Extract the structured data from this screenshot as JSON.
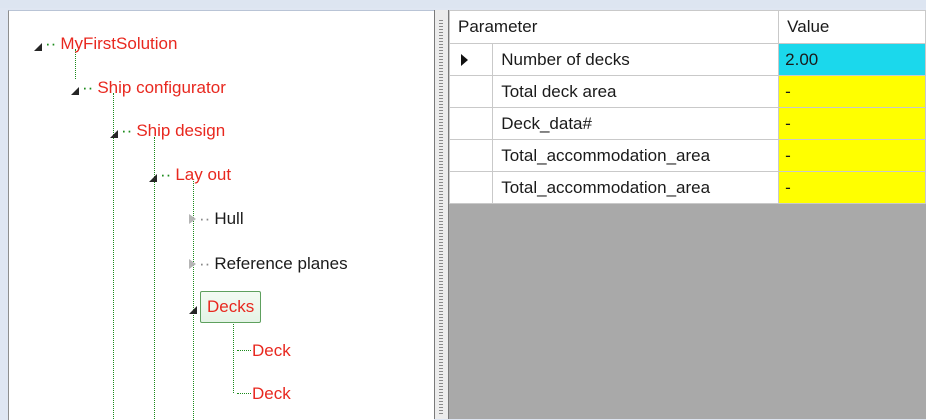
{
  "tree": {
    "root": "MyFirstSolution",
    "ship_configurator": "Ship configurator",
    "ship_design": "Ship design",
    "lay_out": "Lay out",
    "hull": "Hull",
    "reference_planes": "Reference planes",
    "decks": "Decks",
    "deck1": "Deck",
    "deck2": "Deck"
  },
  "grid": {
    "headers": {
      "parameter": "Parameter",
      "value": "Value"
    },
    "rows": [
      {
        "parameter": "Number of decks",
        "value": "2.00",
        "color": "#1bd8ec",
        "current": true
      },
      {
        "parameter": "Total deck area",
        "value": "-",
        "color": "#ffff00",
        "current": false
      },
      {
        "parameter": "Deck_data#",
        "value": "-",
        "color": "#ffff00",
        "current": false
      },
      {
        "parameter": "Total_accommodation_area",
        "value": "-",
        "color": "#ffff00",
        "current": false
      },
      {
        "parameter": "Total_accommodation_area",
        "value": "-",
        "color": "#ffff00",
        "current": false
      }
    ]
  }
}
